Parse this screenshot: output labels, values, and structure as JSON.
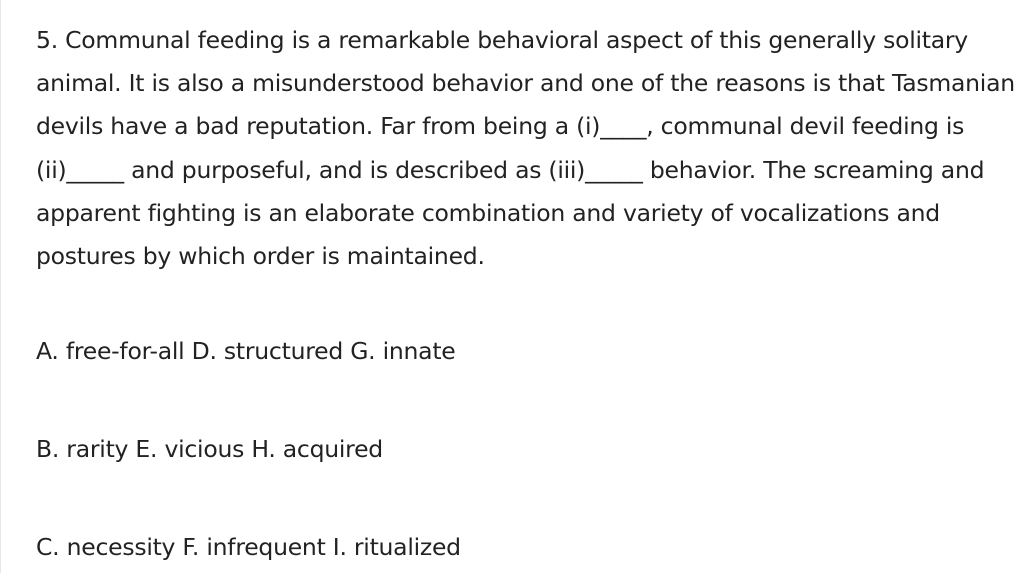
{
  "question": {
    "lines": [
      "5. Communal feeding is a remarkable behavioral aspect of this generally solitary",
      "animal. It is also a misunderstood behavior and one of the reasons is that Tasmanian",
      "devils have a bad reputation.  Far from being a (i)____, communal devil feeding is",
      "(ii)_____ and purposeful, and is described as  (iii)_____ behavior. The screaming and",
      "apparent fighting is an elaborate combination and variety of vocalizations and",
      "postures by which order is maintained."
    ]
  },
  "options": {
    "row_a": "A. free-for-all D. structured G. innate",
    "row_b": "B. rarity E. vicious H. acquired",
    "row_c": "C. necessity F. infrequent I. ritualized"
  }
}
